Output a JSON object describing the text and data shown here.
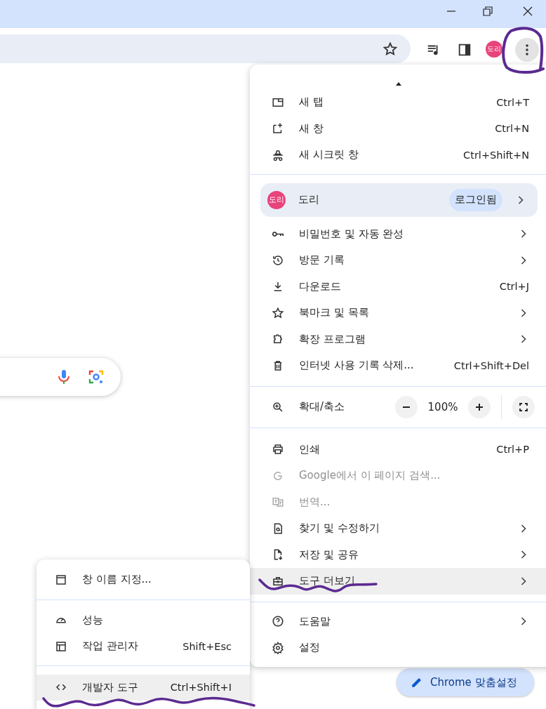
{
  "toolbar": {
    "avatar": "도리"
  },
  "menu": {
    "sections": [
      {
        "items": [
          {
            "kind": "item",
            "label": "새 탭",
            "shortcut": "Ctrl+T",
            "submenu": false,
            "disabled": false,
            "selected": false
          },
          {
            "kind": "item",
            "label": "새 창",
            "shortcut": "Ctrl+N",
            "submenu": false,
            "disabled": false,
            "selected": false
          },
          {
            "kind": "item",
            "label": "새 시크릿 창",
            "shortcut": "Ctrl+Shift+N",
            "submenu": false,
            "disabled": false,
            "selected": false
          }
        ]
      },
      {
        "items": [
          {
            "kind": "profile",
            "avatar": "도리",
            "label": "도리",
            "badge": "로그인됨",
            "submenu": true,
            "selected": false
          },
          {
            "kind": "item",
            "label": "비밀번호 및 자동 완성",
            "submenu": true,
            "disabled": false,
            "selected": false
          },
          {
            "kind": "item",
            "label": "방문 기록",
            "submenu": true,
            "disabled": false,
            "selected": false
          },
          {
            "kind": "item",
            "label": "다운로드",
            "shortcut": "Ctrl+J",
            "submenu": false,
            "disabled": false,
            "selected": false
          },
          {
            "kind": "item",
            "label": "북마크 및 목록",
            "submenu": true,
            "disabled": false,
            "selected": false
          },
          {
            "kind": "item",
            "label": "확장 프로그램",
            "submenu": true,
            "disabled": false,
            "selected": false
          },
          {
            "kind": "item",
            "label": "인터넷 사용 기록 삭제...",
            "shortcut": "Ctrl+Shift+Del",
            "submenu": false,
            "disabled": false,
            "selected": false
          }
        ]
      },
      {
        "items": [
          {
            "kind": "zoom",
            "label": "확대/축소",
            "value": "100%",
            "selected": false
          }
        ]
      },
      {
        "items": [
          {
            "kind": "item",
            "label": "인쇄",
            "shortcut": "Ctrl+P",
            "submenu": false,
            "disabled": false,
            "selected": false
          },
          {
            "kind": "item",
            "label": "Google에서 이 페이지 검색...",
            "submenu": false,
            "disabled": true,
            "selected": false
          },
          {
            "kind": "item",
            "label": "번역...",
            "submenu": false,
            "disabled": true,
            "selected": false
          },
          {
            "kind": "item",
            "label": "찾기 및 수정하기",
            "submenu": true,
            "disabled": false,
            "selected": false
          },
          {
            "kind": "item",
            "label": "저장 및 공유",
            "submenu": true,
            "disabled": false,
            "selected": false
          },
          {
            "kind": "item",
            "label": "도구 더보기",
            "submenu": true,
            "disabled": false,
            "selected": true
          }
        ]
      },
      {
        "items": [
          {
            "kind": "item",
            "label": "도움말",
            "submenu": true,
            "disabled": false,
            "selected": false
          },
          {
            "kind": "item",
            "label": "설정",
            "submenu": false,
            "disabled": false,
            "selected": false
          }
        ]
      }
    ]
  },
  "submenu": {
    "sections": [
      {
        "items": [
          {
            "kind": "item",
            "label": "창 이름 지정...",
            "submenu": false,
            "disabled": false,
            "selected": false
          }
        ]
      },
      {
        "items": [
          {
            "kind": "item",
            "label": "성능",
            "submenu": false,
            "disabled": false,
            "selected": false
          },
          {
            "kind": "item",
            "label": "작업 관리자",
            "shortcut": "Shift+Esc",
            "submenu": false,
            "disabled": false,
            "selected": false
          }
        ]
      },
      {
        "items": [
          {
            "kind": "item",
            "label": "개발자 도구",
            "shortcut": "Ctrl+Shift+I",
            "submenu": false,
            "disabled": false,
            "selected": true
          }
        ]
      }
    ]
  },
  "customize_button": {
    "label": "Chrome 맞춤설정"
  }
}
